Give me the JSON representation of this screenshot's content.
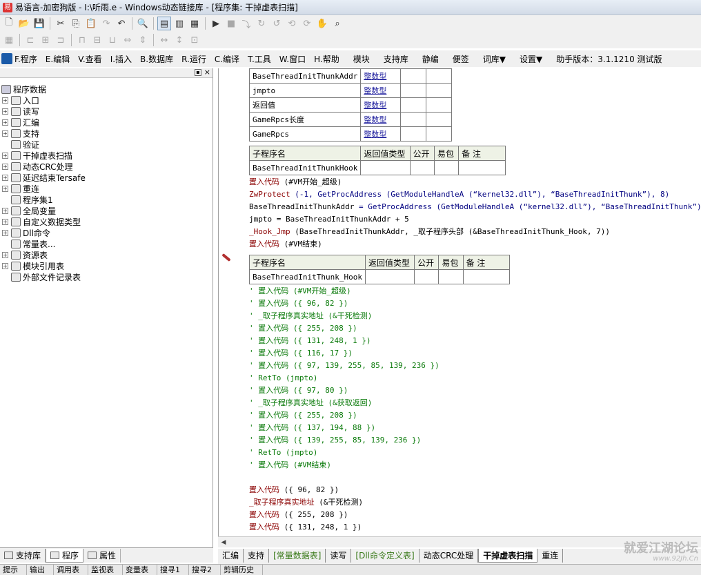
{
  "window": {
    "title": "易语言-加密狗版 - I:\\听雨.e - Windows动态链接库 - [程序集: 干掉虚表扫描]"
  },
  "menubar": {
    "items": [
      "F.程序",
      "E.编辑",
      "V.查看",
      "I.插入",
      "B.数据库",
      "R.运行",
      "C.编译",
      "T.工具",
      "W.窗口",
      "H.帮助"
    ],
    "extras": [
      "模块",
      "支持库",
      "静编",
      "便签",
      "词库▼",
      "设置▼",
      "助手版本：3.1.1210 测试版"
    ]
  },
  "tree": {
    "root": "程序数据",
    "items": [
      "入口",
      "读写",
      "汇编",
      "支持",
      "验证",
      "干掉虚表扫描",
      "动态CRC处理",
      "延迟结束Tersafe",
      "重连",
      "程序集1",
      "全局变量",
      "自定义数据类型",
      "Dll命令",
      "常量表...",
      "资源表",
      "模块引用表",
      "外部文件记录表"
    ]
  },
  "left_tabs": [
    "支持库",
    "程序",
    "属性"
  ],
  "var_table": {
    "rows": [
      {
        "name": "BaseThreadInitThunkAddr",
        "type": "整数型"
      },
      {
        "name": "jmpto",
        "type": "整数型"
      },
      {
        "name": "返回值",
        "type": "整数型"
      },
      {
        "name": "GameRpcs长度",
        "type": "整数型"
      },
      {
        "name": "GameRpcs",
        "type": "整数型"
      }
    ]
  },
  "sub_header_cols": [
    "子程序名",
    "返回值类型",
    "公开",
    "易包",
    "备 注"
  ],
  "sub1": {
    "name": "BaseThreadInitThunkHook",
    "lines": [
      {
        "kw": "置入代码",
        "rest": " (#VM开始_超级)"
      },
      {
        "kw": "ZwProtect",
        "rest": " (-1, GetProcAddress (GetModuleHandleA (“kernel32.dll”), “BaseThreadInitThunk”), 8)"
      },
      {
        "kw": "BaseThreadInitThunkAddr",
        "rest": " = GetProcAddress (GetModuleHandleA (“kernel32.dll”), “BaseThreadInitThunk”)"
      },
      {
        "kw": "jmpto",
        "rest": " = BaseThreadInitThunkAddr + 5"
      },
      {
        "kw": "_Hook_Jmp",
        "rest": " (BaseThreadInitThunkAddr, _取子程序头部 (&BaseThreadInitThunk_Hook, 7))"
      },
      {
        "kw": "置入代码",
        "rest": " (#VM结束)"
      }
    ]
  },
  "sub2": {
    "name": "BaseThreadInitThunk_Hook",
    "comment_lines": [
      "' 置入代码 (#VM开始_超级)",
      "' 置入代码 ({ 96, 82 })",
      "' _取子程序真实地址 (&干死检测)",
      "' 置入代码 ({ 255, 208 })",
      "' 置入代码 ({ 131, 248, 1 })",
      "' 置入代码 ({ 116, 17 })",
      "' 置入代码 ({ 97, 139, 255, 85, 139, 236 })",
      "' RetTo (jmpto)",
      "' 置入代码 ({ 97, 80 })",
      "' _取子程序真实地址 (&获取返回)",
      "' 置入代码 ({ 255, 208 })",
      "' 置入代码 ({ 137, 194, 88 })",
      "' 置入代码 ({ 139, 255, 85, 139, 236 })",
      "' RetTo (jmpto)",
      "' 置入代码 (#VM结束)"
    ],
    "code_lines": [
      {
        "kw": "置入代码",
        "rest": " ({ 96, 82 })"
      },
      {
        "kw": "_取子程序真实地址",
        "rest": " (&干死检测)"
      },
      {
        "kw": "置入代码",
        "rest": " ({ 255, 208 })"
      },
      {
        "kw": "置入代码",
        "rest": " ({ 131, 248, 1 })"
      }
    ]
  },
  "code_tabs": [
    "汇编",
    "支持",
    "[常量数据表]",
    "读写",
    "[Dll命令定义表]",
    "动态CRC处理",
    "干掉虚表扫描",
    "重连"
  ],
  "watermark": {
    "text": "就爱江湖论坛",
    "url": "www.92Jh.Cn"
  },
  "status_tabs": [
    "提示",
    "输出",
    "调用表",
    "监视表",
    "变量表",
    "搜寻1",
    "搜寻2",
    "剪辑历史"
  ]
}
